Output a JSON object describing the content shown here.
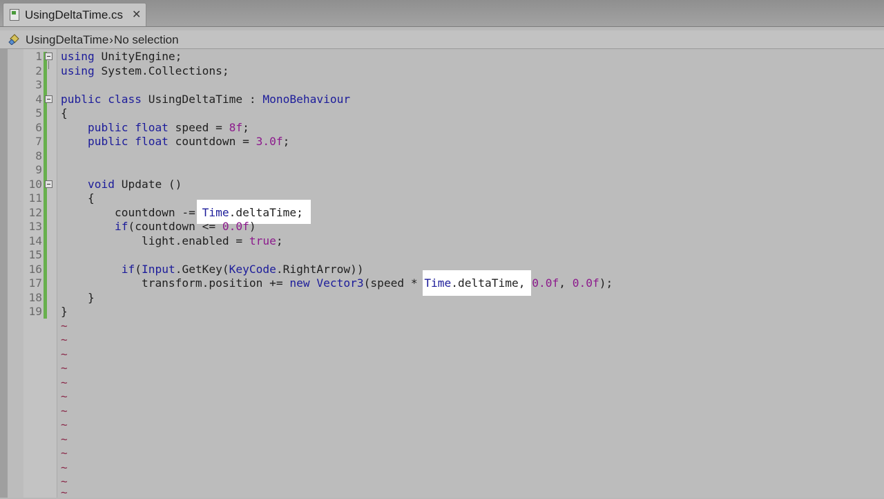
{
  "tab": {
    "title": "UsingDeltaTime.cs",
    "close": "✕"
  },
  "pathbar": {
    "class_name": "UsingDeltaTime",
    "separator": "›",
    "member": "No selection"
  },
  "line_numbers": [
    "1",
    "2",
    "3",
    "4",
    "5",
    "6",
    "7",
    "8",
    "9",
    "10",
    "11",
    "12",
    "13",
    "14",
    "15",
    "16",
    "17",
    "18",
    "19"
  ],
  "code": {
    "l1": [
      "using",
      " UnityEngine;"
    ],
    "l2": [
      "using",
      " System.Collections;"
    ],
    "l4": [
      "public class",
      " UsingDeltaTime : ",
      "MonoBehaviour"
    ],
    "l5": "{",
    "l6": [
      "    ",
      "public float",
      " speed = ",
      "8f",
      ";"
    ],
    "l7": [
      "    ",
      "public float",
      " countdown = ",
      "3.0f",
      ";"
    ],
    "l10": [
      "    ",
      "void",
      " Update ()"
    ],
    "l11": "    {",
    "l12": [
      "        countdown -= ",
      "Time",
      ".deltaTime;"
    ],
    "l13": [
      "        ",
      "if",
      "(countdown <= ",
      "0.0f",
      ")"
    ],
    "l14": [
      "            light.enabled = ",
      "true",
      ";"
    ],
    "l16": [
      "         ",
      "if",
      "(",
      "Input",
      ".GetKey(",
      "KeyCode",
      ".RightArrow))"
    ],
    "l17": [
      "            transform.position += ",
      "new",
      " ",
      "Vector3",
      "(speed * ",
      "Time",
      ".deltaTime, ",
      "0.0f",
      ", ",
      "0.0f",
      ");"
    ],
    "l18": "    }",
    "l19": "}"
  },
  "tilde": "~",
  "colors": {
    "keyword": "#1c1c9a",
    "number": "#8c1a8c",
    "highlight": "#ffffff",
    "changebar": "#68b04d"
  }
}
